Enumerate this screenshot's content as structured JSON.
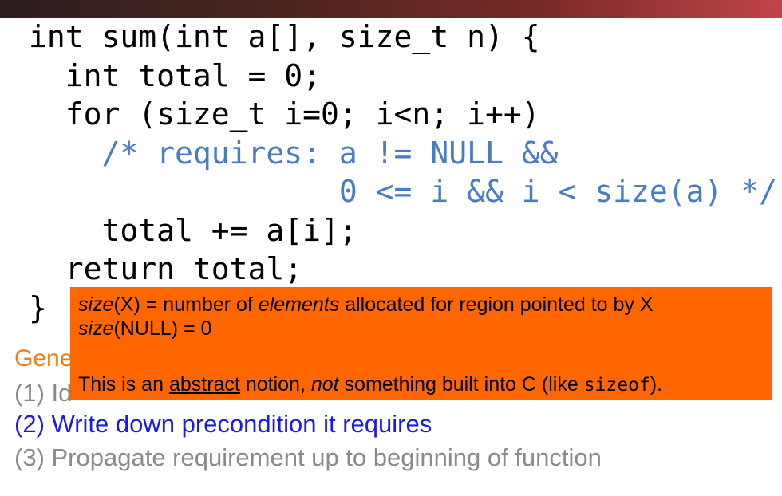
{
  "code_lines": [
    "int sum(int a[], size_t n) {",
    "  int total = 0;",
    "  for (size_t i=0; i<n; i++)",
    "    /* requires: a != NULL &&",
    "                 0 <= i && i < size(a) */",
    "    total += a[i];",
    "  return total;",
    "}"
  ],
  "general_label": "Gene",
  "steps": [
    "(1) Id",
    "(2) Write down precondition it requires",
    "(3) Propagate requirement up to beginning of function"
  ],
  "popup": {
    "line1": {
      "term": "size",
      "arg": "(X) = number of ",
      "em": "elements",
      "rest": " allocated for region pointed to by X"
    },
    "line2": {
      "term": "size",
      "rest": "(NULL) = 0"
    },
    "line3": {
      "pre": "This is an ",
      "underlined": "abstract",
      "mid": " notion, ",
      "em": "not",
      "post": " something built into C (like ",
      "code": "sizeof",
      "end": ")."
    }
  },
  "colors": {
    "accent_orange": "#ff6600",
    "comment_blue": "#4a7cc1",
    "step_blue": "#1a1ae6",
    "muted_gray": "#8a8a8a",
    "label_orange": "#f47a10"
  }
}
